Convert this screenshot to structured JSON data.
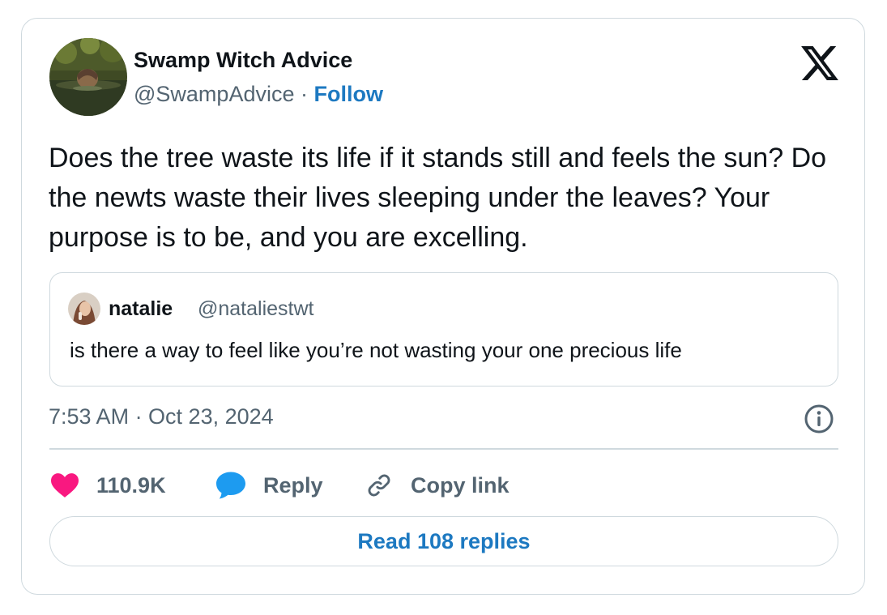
{
  "author": {
    "name": "Swamp Witch Advice",
    "handle": "@SwampAdvice",
    "separator": "·",
    "follow_label": "Follow"
  },
  "tweet": {
    "text": "Does the tree waste its life if it stands still and feels the sun? Do the newts waste their lives sleeping under the leaves? Your purpose is to be, and you are excelling."
  },
  "quoted": {
    "name": "natalie",
    "handle": "@nataliestwt",
    "text": "is there a way to feel like you’re not wasting your one precious life"
  },
  "meta": {
    "timestamp": "7:53 AM · Oct 23, 2024"
  },
  "actions": {
    "likes": "110.9K",
    "reply_label": "Reply",
    "copy_label": "Copy link"
  },
  "read_replies_label": "Read 108 replies",
  "icons": {
    "like": "heart-icon",
    "reply": "speech-bubble-icon",
    "copy": "link-icon",
    "info": "info-icon",
    "brand": "x-logo-icon"
  },
  "colors": {
    "link": "#1d79c1",
    "like": "#f91880",
    "reply": "#1d9bf0",
    "muted": "#536471",
    "text": "#0f1419",
    "border": "#cfd9de"
  }
}
